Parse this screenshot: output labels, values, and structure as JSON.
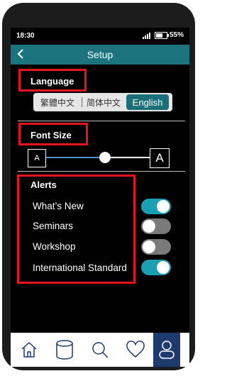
{
  "status": {
    "time": "18:30",
    "battery": "55%",
    "battery_level": 0.55
  },
  "header": {
    "title": "Setup",
    "back_icon": "chevron-left-icon"
  },
  "language": {
    "label": "Language",
    "options": [
      "繁體中文",
      "简体中文",
      "English"
    ],
    "selected": "English"
  },
  "font_size": {
    "label": "Font Size",
    "small_label": "A",
    "large_label": "A",
    "level": 0.5
  },
  "alerts": {
    "label": "Alerts",
    "items": [
      {
        "label": "What’s New",
        "on": true
      },
      {
        "label": "Seminars",
        "on": false
      },
      {
        "label": "Workshop",
        "on": false
      },
      {
        "label": "International Standard",
        "on": true
      }
    ]
  },
  "nav": {
    "items": [
      "home-icon",
      "database-icon",
      "search-icon",
      "heart-icon",
      "profile-icon"
    ],
    "active": "profile-icon"
  },
  "colors": {
    "header": "#1a737d",
    "accent": "#1a9fb3",
    "toggle_off": "#7a7a7a",
    "annotation_red": "#e8141c",
    "nav_active": "#1f3a6e"
  }
}
